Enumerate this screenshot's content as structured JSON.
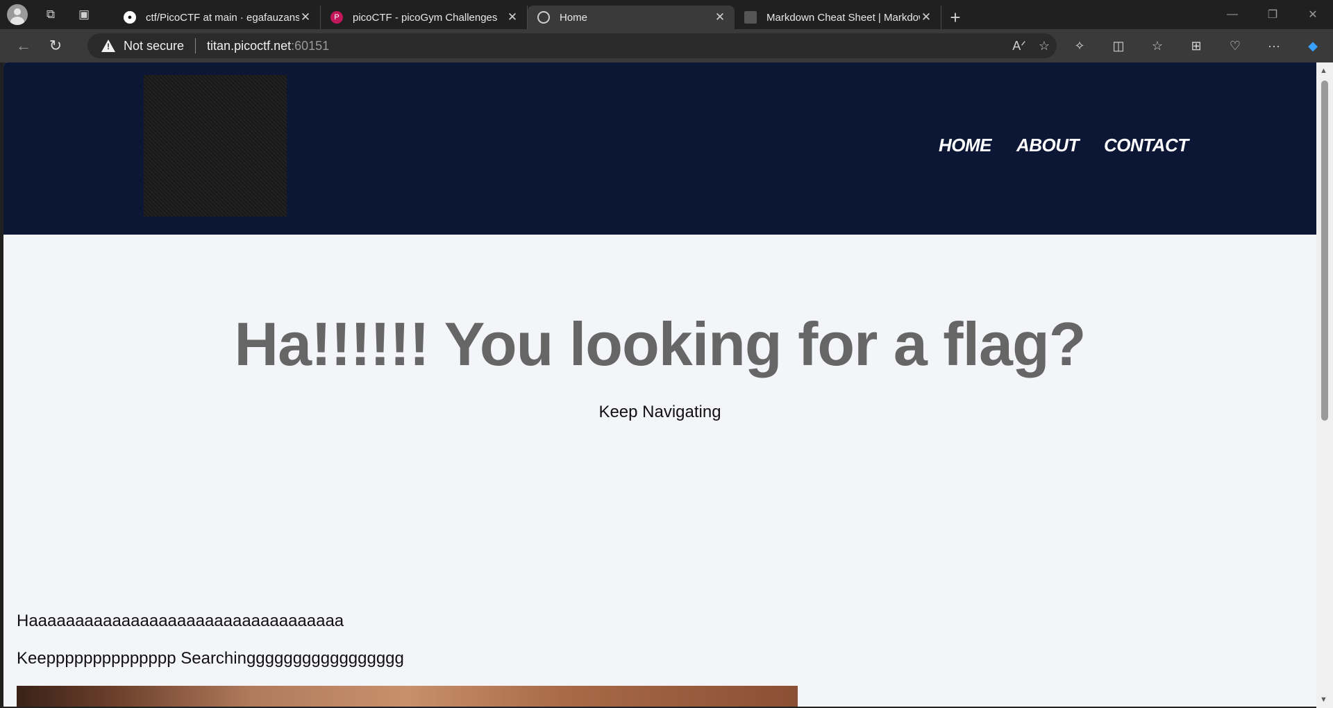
{
  "browser": {
    "tabs": [
      {
        "title": "ctf/PicoCTF at main · egafauzans/",
        "favicon": "github-icon"
      },
      {
        "title": "picoCTF - picoGym Challenges",
        "favicon": "picoctf-icon"
      },
      {
        "title": "Home",
        "favicon": "compass-icon",
        "active": true
      },
      {
        "title": "Markdown Cheat Sheet | Markdow",
        "favicon": "markdown-icon"
      }
    ],
    "security_label": "Not secure",
    "url_host": "titan.picoctf.net",
    "url_port": ":60151"
  },
  "site": {
    "nav": {
      "home": "HOME",
      "about": "ABOUT",
      "contact": "CONTACT"
    },
    "hero": {
      "title": "Ha!!!!!! You looking for a flag?",
      "subtitle": "Keep Navigating"
    },
    "body": {
      "line1": "Haaaaaaaaaaaaaaaaaaaaaaaaaaaaaaaaaa",
      "line2": "Keepppppppppppppp Searchinggggggggggggggggg"
    }
  },
  "colors": {
    "header_bg": "#0b1735",
    "page_bg": "#f4f5f8",
    "hero_text": "#666666"
  }
}
